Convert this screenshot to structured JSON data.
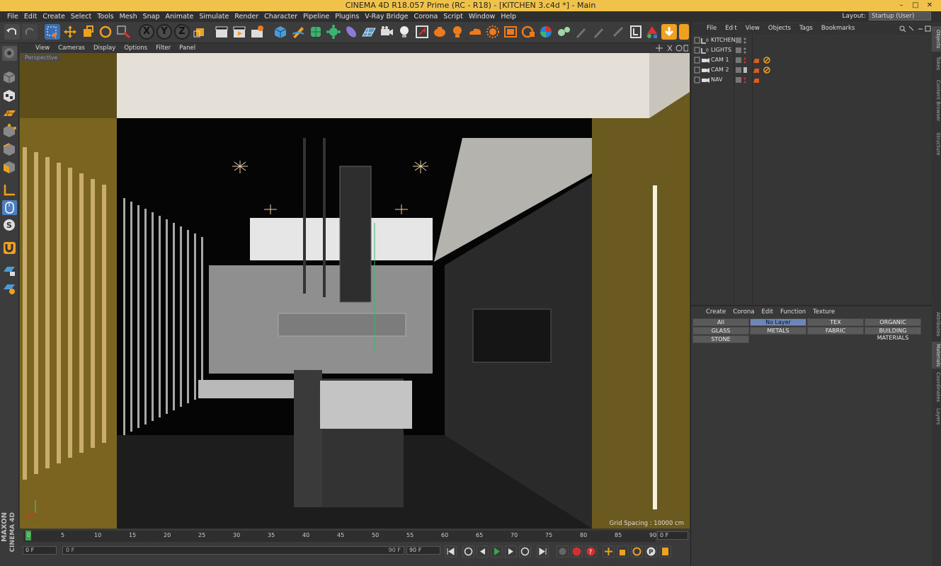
{
  "window": {
    "title": "CINEMA 4D R18.057 Prime (RC - R18) - [KITCHEN 3.c4d *] - Main",
    "controls": [
      "–",
      "□",
      "✕"
    ]
  },
  "menubar": {
    "items": [
      "File",
      "Edit",
      "Create",
      "Select",
      "Tools",
      "Mesh",
      "Snap",
      "Animate",
      "Simulate",
      "Render",
      "Character",
      "Pipeline",
      "Plugins",
      "V-Ray Bridge",
      "Corona",
      "Script",
      "Window",
      "Help"
    ],
    "layout_label": "Layout:",
    "layout_value": "Startup (User)"
  },
  "toolbar": {
    "buttons": [
      "undo",
      "redo",
      "live-selection",
      "move",
      "scale",
      "rotate",
      "recent-tools",
      "x-axis",
      "y-axis",
      "z-axis",
      "world-coordinates",
      "render-view",
      "render-picture-viewer",
      "edit-render-settings",
      "cube",
      "pen",
      "subdivision",
      "array",
      "deformer",
      "floor",
      "camera",
      "light",
      "takes",
      "corona-1",
      "corona-2",
      "corona-3",
      "corona-4",
      "corona-5",
      "corona-6",
      "corona-7",
      "corona-8",
      "corona-9",
      "corona-10",
      "corona-11",
      "vray-1",
      "vray-2",
      "vray-3"
    ],
    "axis_labels": [
      "X",
      "Y",
      "Z"
    ]
  },
  "viewport": {
    "menu": [
      "View",
      "Cameras",
      "Display",
      "Options",
      "Filter",
      "Panel"
    ],
    "label": "Perspective",
    "grid_spacing": "Grid Spacing : 10000 cm"
  },
  "timeline": {
    "ticks": [
      "0",
      "5",
      "10",
      "15",
      "20",
      "25",
      "30",
      "35",
      "40",
      "45",
      "50",
      "55",
      "60",
      "65",
      "70",
      "75",
      "80",
      "85",
      "90"
    ],
    "current_frame": "0 F",
    "start_field": "0 F",
    "min_field": "0 F",
    "max_field": "90 F",
    "end_field": "90 F"
  },
  "objects_panel": {
    "menu": [
      "File",
      "Edit",
      "View",
      "Objects",
      "Tags",
      "Bookmarks"
    ],
    "rows": [
      {
        "name": "KITCHEN"
      },
      {
        "name": "LIGHTS"
      },
      {
        "name": "CAM 1"
      },
      {
        "name": "CAM 2"
      },
      {
        "name": "NAV"
      }
    ]
  },
  "materials_panel": {
    "menu": [
      "Create",
      "Corona",
      "Edit",
      "Function",
      "Texture"
    ],
    "layers": [
      "All",
      "No Layer",
      "TEX",
      "ORGANIC",
      "GLASS",
      "METALS",
      "FABRIC",
      "BUILDING MATERIALS",
      "STONE"
    ],
    "active_layer": "No Layer"
  },
  "side_tabs": [
    "Objects",
    "Takes",
    "Content Browser",
    "Structure",
    "Attributes",
    "Materials",
    "Coordinates",
    "Layers"
  ],
  "brand": {
    "line1": "MAXON",
    "line2": "CINEMA 4D"
  },
  "colors": {
    "title_bar": "#f0c24a",
    "viewport_bg": "#6b5a1f",
    "active_layer": "#6d86b3",
    "playhead": "#3fa34d"
  }
}
